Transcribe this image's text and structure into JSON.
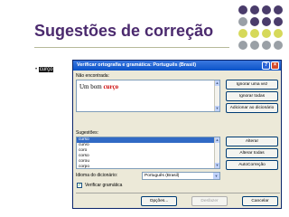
{
  "slide": {
    "title": "Sugestões de correção",
    "bullet_text": "curço",
    "dot_colors": [
      "#4a3c6b",
      "#9aa0a6",
      "#d6d95a"
    ]
  },
  "dialog": {
    "title": "Verificar ortografia e gramática: Português (Brasil)",
    "not_found_label": "Não encontrada:",
    "text_before": "Um bom ",
    "text_error": "curço",
    "suggestions_label": "Sugestões:",
    "suggestions": [
      "curso",
      "curvo",
      "coro",
      "corso",
      "corou",
      "corpo"
    ],
    "language_label": "Idioma do dicionário:",
    "language_value": "Português (Brasil)",
    "grammar_check_label": "Verificar gramática",
    "grammar_checked": true,
    "buttons": {
      "ignore_once": "Ignorar uma vez",
      "ignore_all": "Ignorar todas",
      "add_dictionary": "Adicionar ao dicionário",
      "change": "Alterar",
      "change_all": "Alterar todas",
      "autocorrect": "AutoCorreção",
      "options": "Opções...",
      "undo": "Desfazer",
      "cancel": "Cancelar"
    }
  }
}
